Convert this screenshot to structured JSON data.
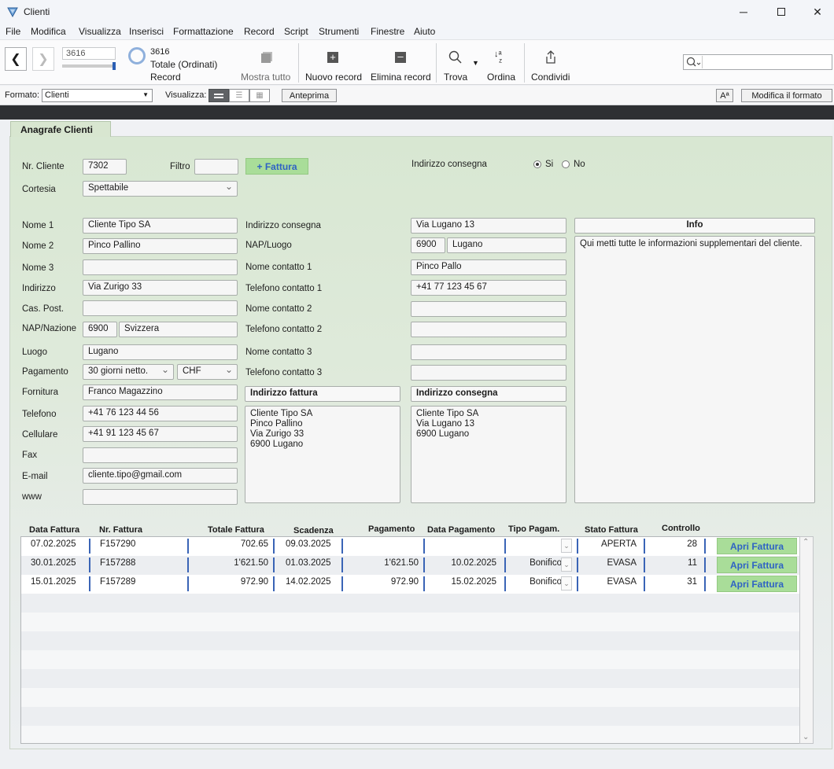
{
  "window": {
    "title": "Clienti"
  },
  "menu": [
    "File",
    "Modifica",
    "Visualizza",
    "Inserisci",
    "Formattazione",
    "Record",
    "Script",
    "Strumenti",
    "Finestre",
    "Aiuto"
  ],
  "toolbar": {
    "record_field": "3616",
    "found_count": "3616",
    "total_label": "Totale (Ordinati)",
    "record_label": "Record",
    "mostra_tutto": "Mostra tutto",
    "nuovo_record": "Nuovo record",
    "elimina_record": "Elimina record",
    "trova": "Trova",
    "ordina": "Ordina",
    "condividi": "Condividi"
  },
  "format_bar": {
    "formato_label": "Formato:",
    "formato_value": "Clienti",
    "visualizza_label": "Visualizza:",
    "anteprima": "Anteprima",
    "aa": "Aª",
    "modifica_formato": "Modifica il formato"
  },
  "tab": "Anagrafe Clienti",
  "top": {
    "nr_cliente_label": "Nr. Cliente",
    "nr_cliente": "7302",
    "filtro_label": "Filtro",
    "filtro": "",
    "fattura_btn": "+ Fattura",
    "ind_consegna_label": "Indirizzo consegna",
    "si": "Si",
    "no": "No",
    "cortesia_label": "Cortesia",
    "cortesia": "Spettabile"
  },
  "left": {
    "labels": [
      "Nome 1",
      "Nome 2",
      "Nome 3",
      "Indirizzo",
      "Cas. Post.",
      "NAP/Nazione",
      "Luogo",
      "Pagamento",
      "Fornitura",
      "Telefono",
      "Cellulare",
      "Fax",
      "E-mail",
      "www"
    ],
    "nome1": "Cliente Tipo SA",
    "nome2": "Pinco Pallino",
    "nome3": "",
    "indirizzo": "Via Zurigo 33",
    "cas_post": "",
    "nap": "6900",
    "nazione": "Svizzera",
    "luogo": "Lugano",
    "pagamento": "30 giorni netto.",
    "valuta": "CHF",
    "fornitura": "Franco Magazzino",
    "telefono": "+41 76 123 44 56",
    "cellulare": "+41 91 123 45 67",
    "fax": "",
    "email": "cliente.tipo@gmail.com",
    "www": ""
  },
  "middle": {
    "labels": [
      "Indirizzo consegna",
      "NAP/Luogo",
      "Nome contatto 1",
      "Telefono contatto 1",
      "Nome contatto 2",
      "Telefono contatto 2",
      "Nome contatto 3",
      "Telefono contatto 3"
    ],
    "ind_consegna": "Via Lugano 13",
    "nap": "6900",
    "luogo": "Lugano",
    "contatto1": "Pinco Pallo",
    "tel1": "+41 77 123 45 67",
    "contatto2": "",
    "tel2": "",
    "contatto3": "",
    "tel3": ""
  },
  "addr": {
    "fattura_title": "Indirizzo fattura",
    "fattura_text": "Cliente Tipo SA\nPinco Pallino\nVia Zurigo 33\n6900 Lugano",
    "consegna_title": "Indirizzo consegna",
    "consegna_text": "Cliente Tipo SA\nVia Lugano 13\n6900 Lugano"
  },
  "info": {
    "title": "Info",
    "text": "Qui metti tutte le informazioni supplementari del cliente."
  },
  "invoices": {
    "headers": [
      "Data Fattura",
      "Nr. Fattura",
      "Totale Fattura",
      "Scadenza",
      "Pagamento",
      "Data Pagamento",
      "Tipo Pagam.",
      "Stato Fattura",
      "Controllo"
    ],
    "button": "Apri Fattura",
    "rows": [
      {
        "data": "07.02.2025",
        "nr": "F157290",
        "totale": "702.65",
        "scadenza": "09.03.2025",
        "pagamento": "",
        "data_pag": "",
        "tipo": "",
        "stato": "APERTA",
        "controllo": "28"
      },
      {
        "data": "30.01.2025",
        "nr": "F157288",
        "totale": "1'621.50",
        "scadenza": "01.03.2025",
        "pagamento": "1'621.50",
        "data_pag": "10.02.2025",
        "tipo": "Bonifico",
        "stato": "EVASA",
        "controllo": "11"
      },
      {
        "data": "15.01.2025",
        "nr": "F157289",
        "totale": "972.90",
        "scadenza": "14.02.2025",
        "pagamento": "972.90",
        "data_pag": "15.02.2025",
        "tipo": "Bonifico",
        "stato": "EVASA",
        "controllo": "31"
      }
    ]
  },
  "colors": {
    "accent_green": "#a9dd99",
    "link_blue": "#2f63c4",
    "panel_green": "#d8e7d2"
  }
}
